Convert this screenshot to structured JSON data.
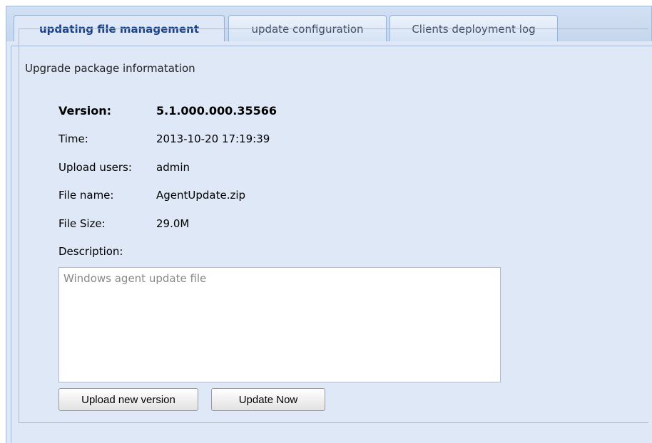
{
  "tabs": [
    {
      "label": "updating file management",
      "active": true
    },
    {
      "label": "update configuration",
      "active": false
    },
    {
      "label": "Clients deployment log",
      "active": false
    }
  ],
  "panel": {
    "legend": "Upgrade package informatation",
    "fields": {
      "version": {
        "label": "Version:",
        "value": "5.1.000.000.35566"
      },
      "time": {
        "label": "Time:",
        "value": "2013-10-20 17:19:39"
      },
      "upload_users": {
        "label": "Upload users:",
        "value": "admin"
      },
      "file_name": {
        "label": "File name:",
        "value": "AgentUpdate.zip"
      },
      "file_size": {
        "label": "File Size:",
        "value": "29.0M"
      }
    },
    "description": {
      "label": "Description:",
      "value": "Windows agent update file"
    },
    "buttons": {
      "upload": "Upload new version",
      "update": "Update Now"
    }
  },
  "colors": {
    "tab_strip": "#c5d6ee",
    "panel_bg": "#dfe8f6",
    "border": "#99bbe8",
    "active_tab_text": "#15428b"
  }
}
